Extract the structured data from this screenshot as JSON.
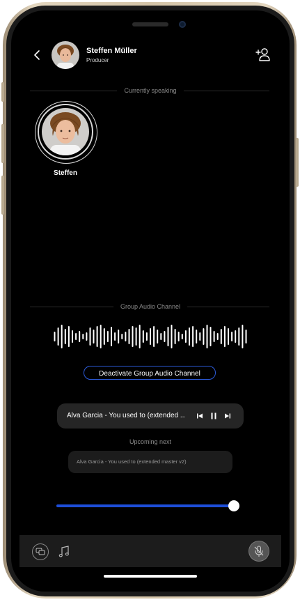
{
  "header": {
    "user_name": "Steffen Müller",
    "user_role": "Producer",
    "back_icon": "chevron-left-icon",
    "add_user_icon": "add-user-icon"
  },
  "speaking": {
    "section_label": "Currently speaking",
    "speaker_name": "Steffen"
  },
  "audio_channel": {
    "section_label": "Group Audio Channel",
    "deactivate_label": "Deactivate Group Audio Channel"
  },
  "player": {
    "track_title": "Alva Garcia - You used to (extended ...",
    "upcoming_label": "Upcoming next",
    "queue_item": "Alva Garcia - You used to (extended master v2)",
    "progress": 0.98
  },
  "bottom_bar": {
    "chat_icon": "chat-icon",
    "music_icon": "music-note-icon",
    "mic_icon": "mic-off-icon"
  },
  "colors": {
    "accent": "#2c5bd9",
    "background": "#000000",
    "frame": "#d4c4a8"
  }
}
